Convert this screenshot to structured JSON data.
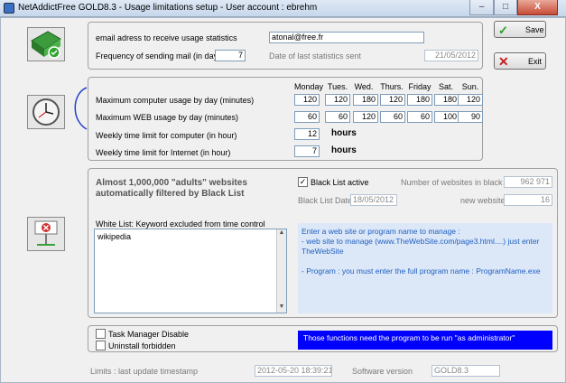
{
  "window": {
    "title": "NetAddictFree  GOLD8.3 - Usage limitations setup - User account : ebrehm",
    "minimize": "–",
    "maximize": "□",
    "close": "X"
  },
  "buttons": {
    "save": "Save",
    "exit": "Exit"
  },
  "mail": {
    "email_label": "email adress to receive usage statistics",
    "email_value": "atonal@free.fr",
    "freq_label": "Frequency of sending mail (in days)",
    "freq_value": "7",
    "last_sent_label": "Date of last statistics sent",
    "last_sent_value": "21/05/2012"
  },
  "usage": {
    "days": [
      "Monday",
      "Tues.",
      "Wed.",
      "Thurs.",
      "Friday",
      "Sat.",
      "Sun."
    ],
    "computer_label": "Maximum computer usage by day (minutes)",
    "computer_values": [
      "120",
      "120",
      "180",
      "120",
      "180",
      "180",
      "120"
    ],
    "web_label": "Maximum WEB usage by day (minutes)",
    "web_values": [
      "60",
      "60",
      "120",
      "60",
      "60",
      "100",
      "90"
    ],
    "weekly_computer_label": "Weekly time limit for computer (in hour)",
    "weekly_computer_value": "12",
    "weekly_internet_label": "Weekly time limit for Internet (in hour)",
    "weekly_internet_value": "7",
    "hours_unit": "hours"
  },
  "blacklist": {
    "headline": "Almost 1,000,000 \"adults\" websites automatically filtered by Black List",
    "active_label": "Black List active",
    "active_checked": "✓",
    "count_label": "Number of websites in black list",
    "count_value": "962 971",
    "date_label": "Black List Date",
    "date_value": "18/05/2012",
    "new_label": "new websites",
    "new_value": "16",
    "whitelist_label": "White List: Keyword excluded from time control",
    "whitelist_value": "wikipedia",
    "help_lines": [
      "Enter a web site or program name to manage :",
      "- web site to manage (www.TheWebSite.com/page3.html....) just enter TheWebSite",
      "",
      "- Program : you must enter the full program name : ProgramName.exe"
    ]
  },
  "admin": {
    "task_manager_label": "Task Manager Disable",
    "uninstall_label": "Uninstall forbidden",
    "note": "Those functions need the program to be run \"as administrator\""
  },
  "footer": {
    "limits_label": "Limits : last update timestamp",
    "limits_value": "2012-05-20 18:39:21",
    "version_label": "Software version",
    "version_value": "GOLD8.3"
  },
  "colors": {
    "note_bg": "#0000ff",
    "help_bg": "#dce8f8",
    "help_text": "#1f5fbf"
  },
  "icons": [
    "app-icon",
    "mail-icon",
    "clock-icon",
    "blacklist-icon",
    "save-icon",
    "exit-icon"
  ]
}
